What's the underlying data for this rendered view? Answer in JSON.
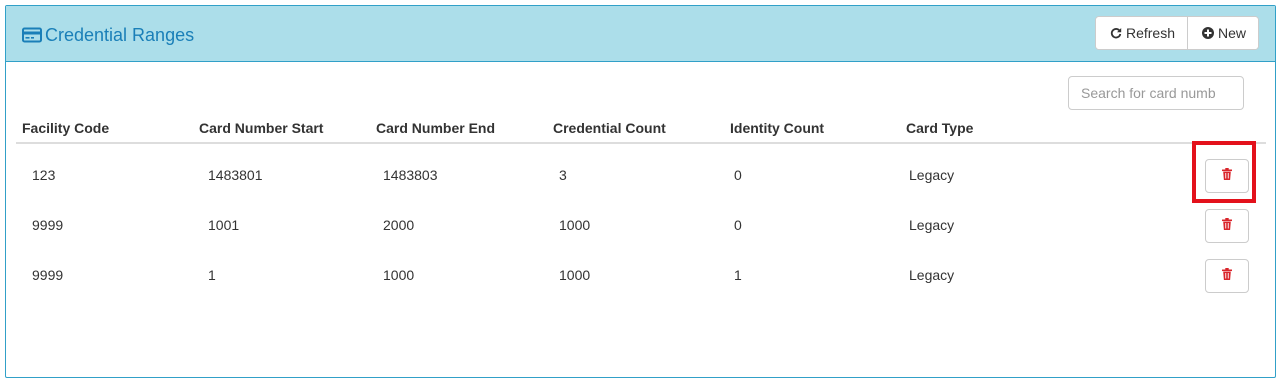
{
  "header": {
    "title": "Credential Ranges",
    "refresh_label": "Refresh",
    "new_label": "New"
  },
  "search": {
    "placeholder": "Search for card numb"
  },
  "table": {
    "columns": [
      "Facility Code",
      "Card Number Start",
      "Card Number End",
      "Credential Count",
      "Identity Count",
      "Card Type"
    ],
    "rows": [
      [
        "123",
        "1483801",
        "1483803",
        "3",
        "0",
        "Legacy"
      ],
      [
        "9999",
        "1001",
        "2000",
        "1000",
        "0",
        "Legacy"
      ],
      [
        "9999",
        "1",
        "1000",
        "1000",
        "1",
        "Legacy"
      ]
    ]
  },
  "colors": {
    "header_bg": "#acdeea",
    "accent": "#1a7fb8",
    "border": "#31a0c8",
    "delete_icon": "#d9242b",
    "highlight": "#e3111b"
  },
  "icons": {
    "title": "credit-card-icon",
    "refresh": "refresh-icon",
    "new": "plus-circle-icon",
    "delete": "trash-icon"
  }
}
